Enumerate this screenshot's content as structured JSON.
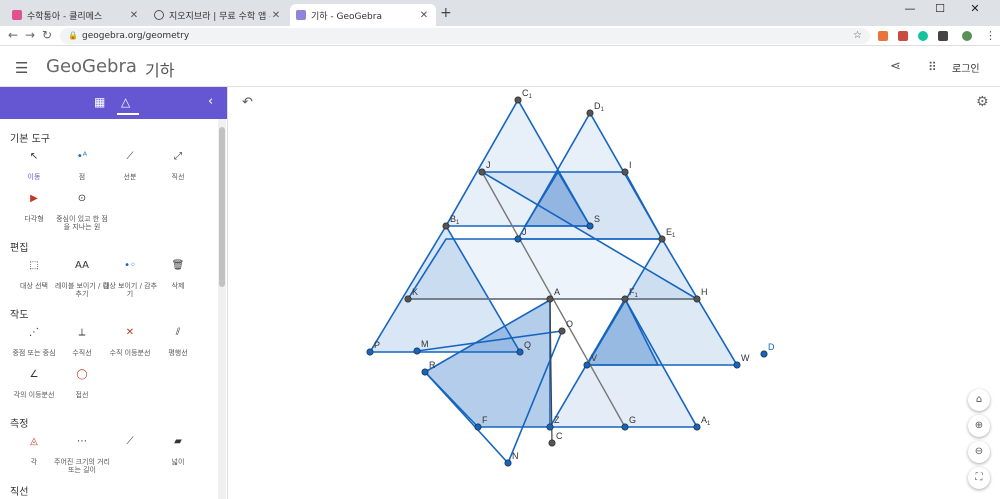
{
  "browser": {
    "tabs": [
      {
        "title": "수학통아 - 클리메스"
      },
      {
        "title": "지오지브라 | 무료 수학 앱 - 전"
      },
      {
        "title": "기하 - GeoGebra"
      }
    ],
    "url": "geogebra.org/geometry"
  },
  "app": {
    "logo": "GeoGebra",
    "title": "기하",
    "login": "로그인"
  },
  "categories": {
    "basic": "기본 도구",
    "edit": "편집",
    "construct": "작도",
    "measure": "측정",
    "lines": "직선"
  },
  "tools": {
    "basic": [
      "이동",
      "점",
      "선분",
      "직선",
      "다각형",
      "중심이 있고 한 점을 지나는 원"
    ],
    "edit": [
      "대상 선택",
      "레이블 보이기 / 감추기",
      "대상 보이기 / 감추기",
      "삭제"
    ],
    "construct": [
      "중점 또는 중심",
      "수직선",
      "수직 이등분선",
      "평행선",
      "각의 이등분선",
      "접선"
    ],
    "measure": [
      "각",
      "주어진 크기의 거리 또는 길이",
      "넓이"
    ]
  },
  "colors": {
    "accent": "#6557d2",
    "shape": "#1565c0"
  },
  "points": [
    {
      "n": "C",
      "s": "1"
    },
    {
      "n": "D",
      "s": "1"
    },
    {
      "n": "J",
      "s": ""
    },
    {
      "n": "I",
      "s": ""
    },
    {
      "n": "B",
      "s": "1"
    },
    {
      "n": "S",
      "s": ""
    },
    {
      "n": "J",
      "s": ""
    },
    {
      "n": "E",
      "s": "1"
    },
    {
      "n": "K",
      "s": ""
    },
    {
      "n": "A",
      "s": ""
    },
    {
      "n": "F",
      "s": "1"
    },
    {
      "n": "H",
      "s": ""
    },
    {
      "n": "O",
      "s": ""
    },
    {
      "n": "P",
      "s": ""
    },
    {
      "n": "M",
      "s": ""
    },
    {
      "n": "Q",
      "s": ""
    },
    {
      "n": "V",
      "s": ""
    },
    {
      "n": "W",
      "s": ""
    },
    {
      "n": "D",
      "s": ""
    },
    {
      "n": "R",
      "s": ""
    },
    {
      "n": "F",
      "s": ""
    },
    {
      "n": "Z",
      "s": ""
    },
    {
      "n": "G",
      "s": ""
    },
    {
      "n": "A",
      "s": "1"
    },
    {
      "n": "C",
      "s": ""
    },
    {
      "n": "N",
      "s": ""
    }
  ]
}
